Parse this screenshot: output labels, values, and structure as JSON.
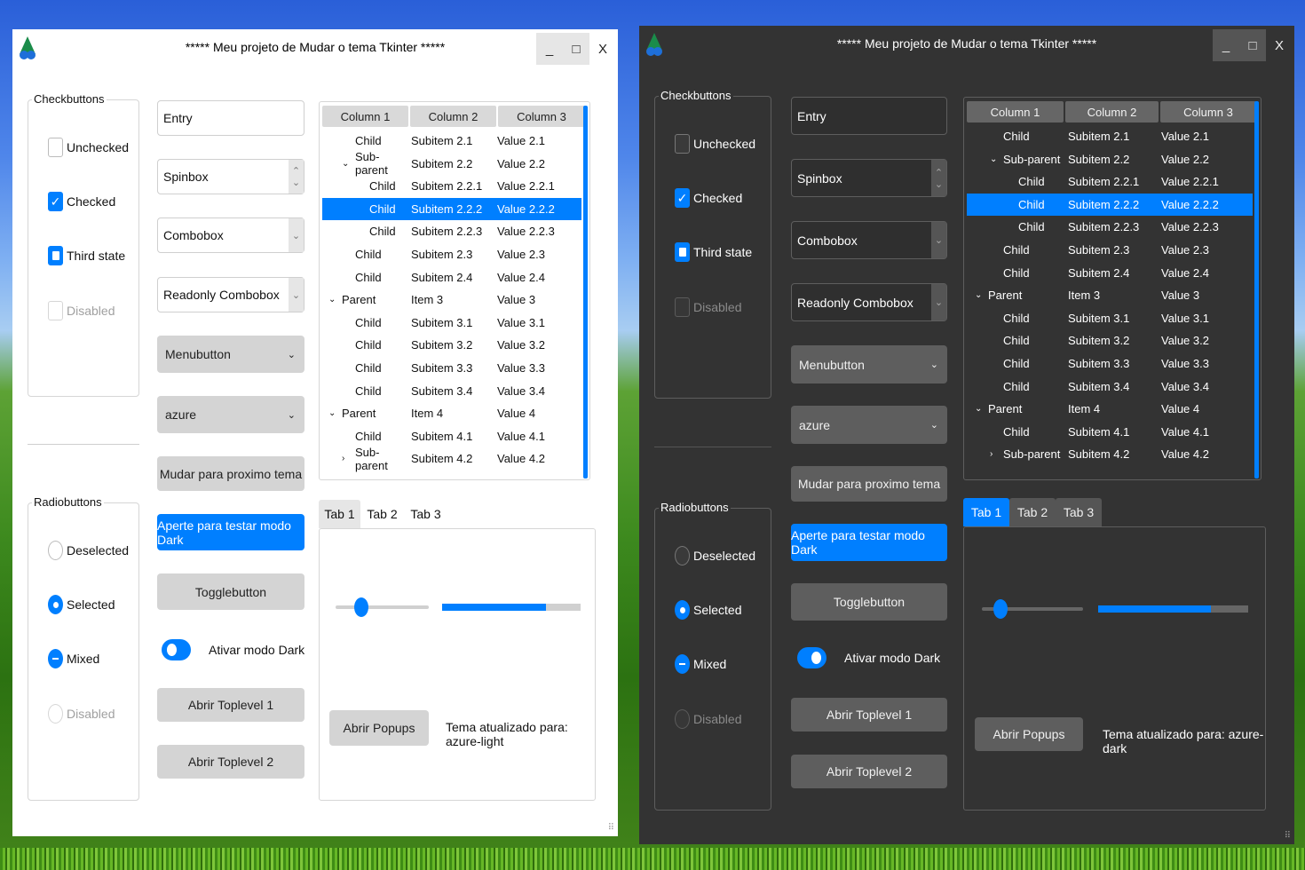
{
  "light": {
    "title": "*****  Meu projeto de Mudar o tema Tkinter  *****",
    "window_controls": {
      "minimize": "_",
      "maximize": "□",
      "close": "X"
    },
    "checkbuttons": {
      "label": "Checkbuttons",
      "items": [
        {
          "label": "Unchecked",
          "state": "unchecked"
        },
        {
          "label": "Checked",
          "state": "checked"
        },
        {
          "label": "Third state",
          "state": "tristate"
        },
        {
          "label": "Disabled",
          "state": "disabled"
        }
      ]
    },
    "radiobuttons": {
      "label": "Radiobuttons",
      "items": [
        {
          "label": "Deselected",
          "state": "off"
        },
        {
          "label": "Selected",
          "state": "on"
        },
        {
          "label": "Mixed",
          "state": "mixed"
        },
        {
          "label": "Disabled",
          "state": "disabled"
        }
      ]
    },
    "entry": "Entry",
    "spinbox": "Spinbox",
    "combobox": "Combobox",
    "readonly_combobox": "Readonly Combobox",
    "menubutton": "Menubutton",
    "theme_menu": "azure",
    "next_theme_button": "Mudar para proximo tema",
    "dark_test_button": "Aperte para testar modo Dark",
    "togglebutton": "Togglebutton",
    "switch_label": "Ativar modo Dark",
    "toplevel1_button": "Abrir Toplevel 1",
    "toplevel2_button": "Abrir Toplevel 2",
    "tabs": [
      "Tab 1",
      "Tab 2",
      "Tab 3"
    ],
    "slider_value_fraction": 0.28,
    "progress_fraction": 0.75,
    "popups_button": "Abrir Popups",
    "status": "Tema atualizado para: azure-light"
  },
  "dark": {
    "title": "*****  Meu projeto de Mudar o tema Tkinter  *****",
    "window_controls": {
      "minimize": "_",
      "maximize": "□",
      "close": "X"
    },
    "checkbuttons": {
      "label": "Checkbuttons",
      "items": [
        {
          "label": "Unchecked",
          "state": "unchecked"
        },
        {
          "label": "Checked",
          "state": "checked"
        },
        {
          "label": "Third state",
          "state": "tristate"
        },
        {
          "label": "Disabled",
          "state": "disabled"
        }
      ]
    },
    "radiobuttons": {
      "label": "Radiobuttons",
      "items": [
        {
          "label": "Deselected",
          "state": "off"
        },
        {
          "label": "Selected",
          "state": "on"
        },
        {
          "label": "Mixed",
          "state": "mixed"
        },
        {
          "label": "Disabled",
          "state": "disabled"
        }
      ]
    },
    "entry": "Entry",
    "spinbox": "Spinbox",
    "combobox": "Combobox",
    "readonly_combobox": "Readonly Combobox",
    "menubutton": "Menubutton",
    "theme_menu": "azure",
    "next_theme_button": "Mudar para proximo tema",
    "dark_test_button": "Aperte para testar modo Dark",
    "togglebutton": "Togglebutton",
    "switch_label": "Ativar modo Dark",
    "toplevel1_button": "Abrir Toplevel 1",
    "toplevel2_button": "Abrir Toplevel 2",
    "tabs": [
      "Tab 1",
      "Tab 2",
      "Tab 3"
    ],
    "slider_value_fraction": 0.18,
    "progress_fraction": 0.75,
    "popups_button": "Abrir Popups",
    "status": "Tema atualizado para: azure-dark"
  },
  "tree": {
    "columns": [
      "Column 1",
      "Column 2",
      "Column 3"
    ],
    "rows": [
      {
        "c1": "Child",
        "c2": "Subitem 2.1",
        "c3": "Value 2.1",
        "level": 1,
        "arrow": ""
      },
      {
        "c1": "Sub-parent",
        "c2": "Subitem 2.2",
        "c3": "Value 2.2",
        "level": 1,
        "arrow": "v"
      },
      {
        "c1": "Child",
        "c2": "Subitem 2.2.1",
        "c3": "Value 2.2.1",
        "level": 2,
        "arrow": ""
      },
      {
        "c1": "Child",
        "c2": "Subitem 2.2.2",
        "c3": "Value 2.2.2",
        "level": 2,
        "arrow": "",
        "selected": true
      },
      {
        "c1": "Child",
        "c2": "Subitem 2.2.3",
        "c3": "Value 2.2.3",
        "level": 2,
        "arrow": ""
      },
      {
        "c1": "Child",
        "c2": "Subitem 2.3",
        "c3": "Value 2.3",
        "level": 1,
        "arrow": ""
      },
      {
        "c1": "Child",
        "c2": "Subitem 2.4",
        "c3": "Value 2.4",
        "level": 1,
        "arrow": ""
      },
      {
        "c1": "Parent",
        "c2": "Item 3",
        "c3": "Value 3",
        "level": 0,
        "arrow": "v"
      },
      {
        "c1": "Child",
        "c2": "Subitem 3.1",
        "c3": "Value 3.1",
        "level": 1,
        "arrow": ""
      },
      {
        "c1": "Child",
        "c2": "Subitem 3.2",
        "c3": "Value 3.2",
        "level": 1,
        "arrow": ""
      },
      {
        "c1": "Child",
        "c2": "Subitem 3.3",
        "c3": "Value 3.3",
        "level": 1,
        "arrow": ""
      },
      {
        "c1": "Child",
        "c2": "Subitem 3.4",
        "c3": "Value 3.4",
        "level": 1,
        "arrow": ""
      },
      {
        "c1": "Parent",
        "c2": "Item 4",
        "c3": "Value 4",
        "level": 0,
        "arrow": "v"
      },
      {
        "c1": "Child",
        "c2": "Subitem 4.1",
        "c3": "Value 4.1",
        "level": 1,
        "arrow": ""
      },
      {
        "c1": "Sub-parent",
        "c2": "Subitem 4.2",
        "c3": "Value 4.2",
        "level": 1,
        "arrow": ">"
      }
    ]
  },
  "colors": {
    "accent": "#007fff",
    "light_bg": "#ffffff",
    "dark_bg": "#333333"
  },
  "icons": {
    "app": "app-logo-icon",
    "resize": "resize-grip-icon"
  }
}
